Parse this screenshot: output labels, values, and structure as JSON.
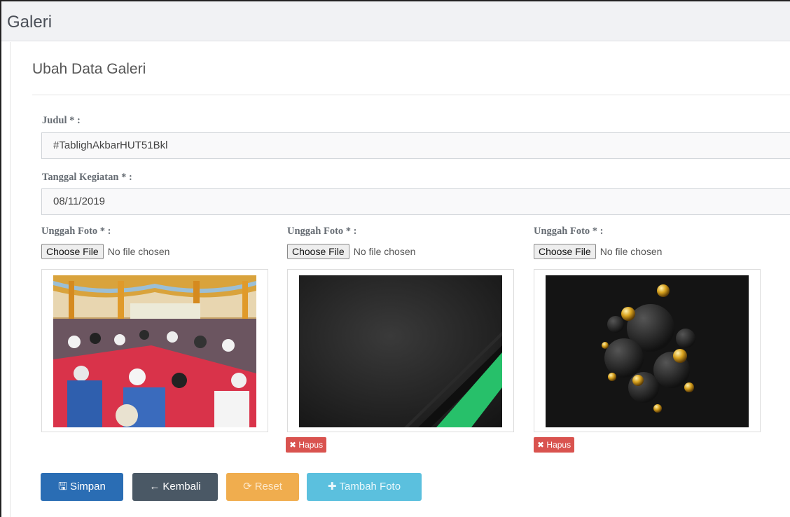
{
  "page": {
    "title": "Galeri"
  },
  "panel": {
    "title": "Ubah Data Galeri"
  },
  "form": {
    "judul": {
      "label": "Judul * :",
      "value": "#TablighAkbarHUT51Bkl"
    },
    "tanggal": {
      "label": "Tanggal Kegiatan * :",
      "value": "08/11/2019"
    },
    "uploads": [
      {
        "label": "Unggah Foto * :",
        "button": "Choose File",
        "status": "No file chosen",
        "preview": "crowd-prayer-photo"
      },
      {
        "label": "Unggah Foto * :",
        "button": "Choose File",
        "status": "No file chosen",
        "preview": "dark-green-stripe-photo",
        "delete_label": "Hapus"
      },
      {
        "label": "Unggah Foto * :",
        "button": "Choose File",
        "status": "No file chosen",
        "preview": "gold-spheres-photo",
        "delete_label": "Hapus"
      }
    ]
  },
  "actions": {
    "simpan": {
      "label": "Simpan",
      "icon": "save-icon",
      "color": "#2a6db4"
    },
    "kembali": {
      "label": "Kembali",
      "icon": "arrow-left-icon",
      "color": "#4a5865"
    },
    "reset": {
      "label": "Reset",
      "icon": "refresh-icon",
      "color": "#f0ad4e"
    },
    "tambah": {
      "label": "Tambah Foto",
      "icon": "plus-icon",
      "color": "#5bc0de"
    }
  },
  "colors": {
    "danger": "#d9534f",
    "header_bg": "#f1f2f4"
  }
}
